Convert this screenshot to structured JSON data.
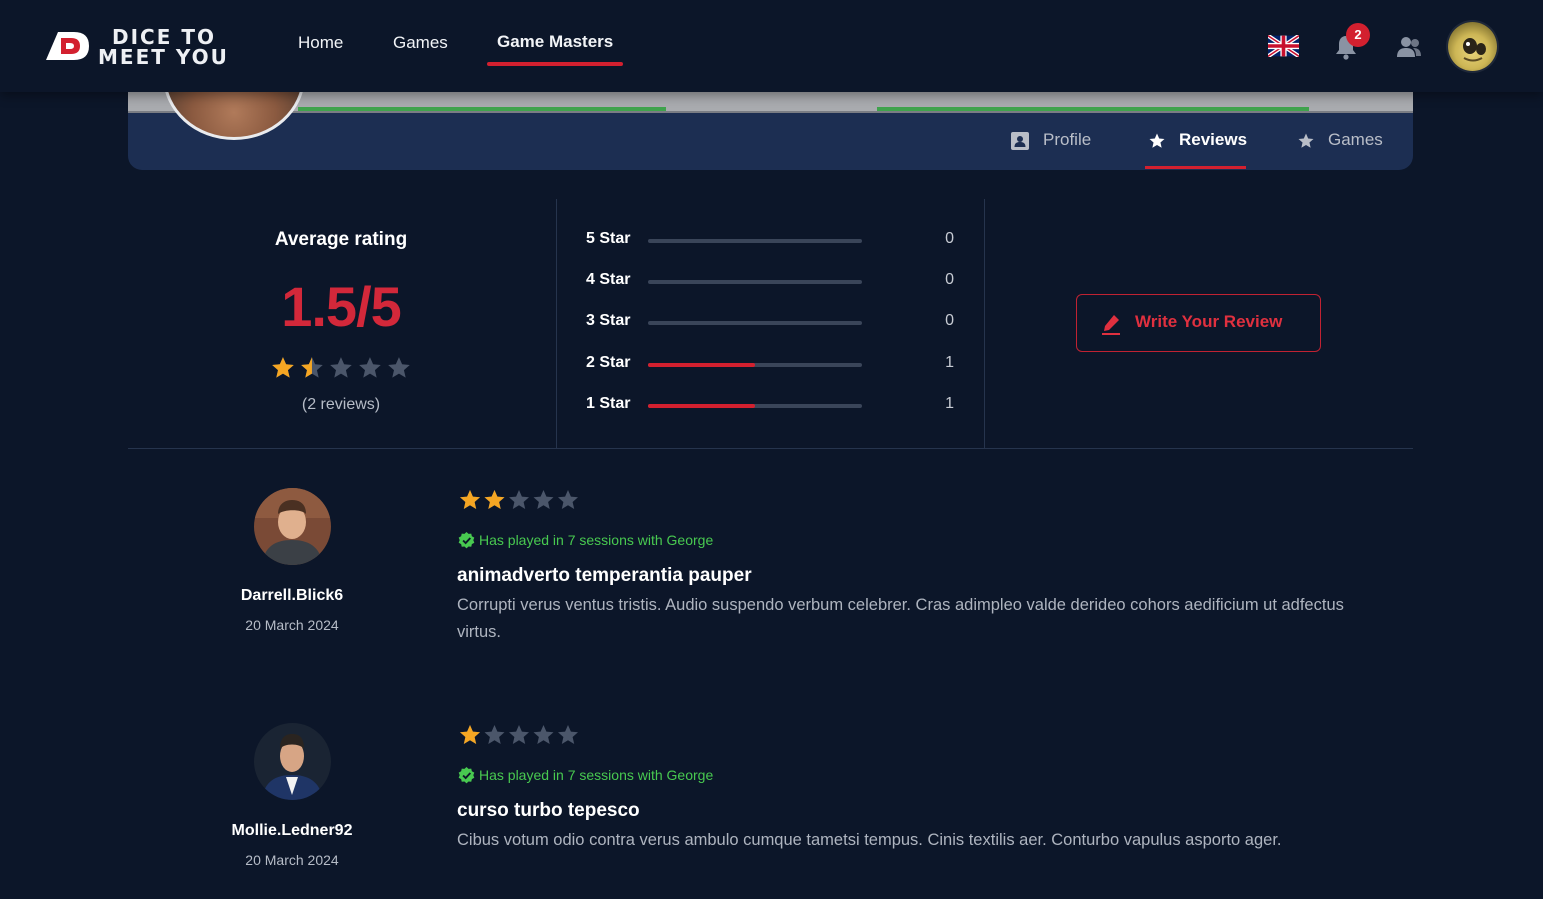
{
  "app": {
    "logo_line1": "DICE TO",
    "logo_line2": "MEET YOU"
  },
  "nav": {
    "items": [
      {
        "label": "Home"
      },
      {
        "label": "Games"
      },
      {
        "label": "Game Masters"
      }
    ],
    "active_index": 2,
    "notifications_count": "2",
    "language_icon": "uk-flag-icon"
  },
  "profile_tabs": {
    "items": [
      {
        "label": "Profile",
        "icon": "contact-card-icon"
      },
      {
        "label": "Reviews",
        "icon": "star-icon"
      },
      {
        "label": "Games",
        "icon": "star-icon"
      }
    ],
    "active_index": 1
  },
  "summary": {
    "title": "Average rating",
    "value": "1.5/5",
    "rating": 1.5,
    "max": 5,
    "count_text": "(2 reviews)",
    "distribution": [
      {
        "label": "5 Star",
        "count": "0",
        "fraction": 0
      },
      {
        "label": "4 Star",
        "count": "0",
        "fraction": 0
      },
      {
        "label": "3 Star",
        "count": "0",
        "fraction": 0
      },
      {
        "label": "2 Star",
        "count": "1",
        "fraction": 0.5
      },
      {
        "label": "1 Star",
        "count": "1",
        "fraction": 0.5
      }
    ],
    "write_button": "Write Your Review"
  },
  "reviews": [
    {
      "author": "Darrell.Blick6",
      "date": "20 March 2024",
      "rating": 2,
      "verified": "Has played in 7 sessions with George",
      "title": "animadverto temperantia pauper",
      "body": "Corrupti verus ventus tristis. Audio suspendo verbum celebrer. Cras adimpleo valde derideo cohors aedificium ut adfectus virtus."
    },
    {
      "author": "Mollie.Ledner92",
      "date": "20 March 2024",
      "rating": 1,
      "verified": "Has played in 7 sessions with George",
      "title": "curso turbo tepesco",
      "body": "Cibus votum odio contra verus ambulo cumque tametsi tempus. Cinis textilis aer. Conturbo vapulus asporto ager."
    }
  ],
  "colors": {
    "background": "#0c1629",
    "accent": "#d3202f",
    "star_filled": "#f5a623",
    "star_empty": "#4b566a",
    "verified": "#48c950"
  }
}
